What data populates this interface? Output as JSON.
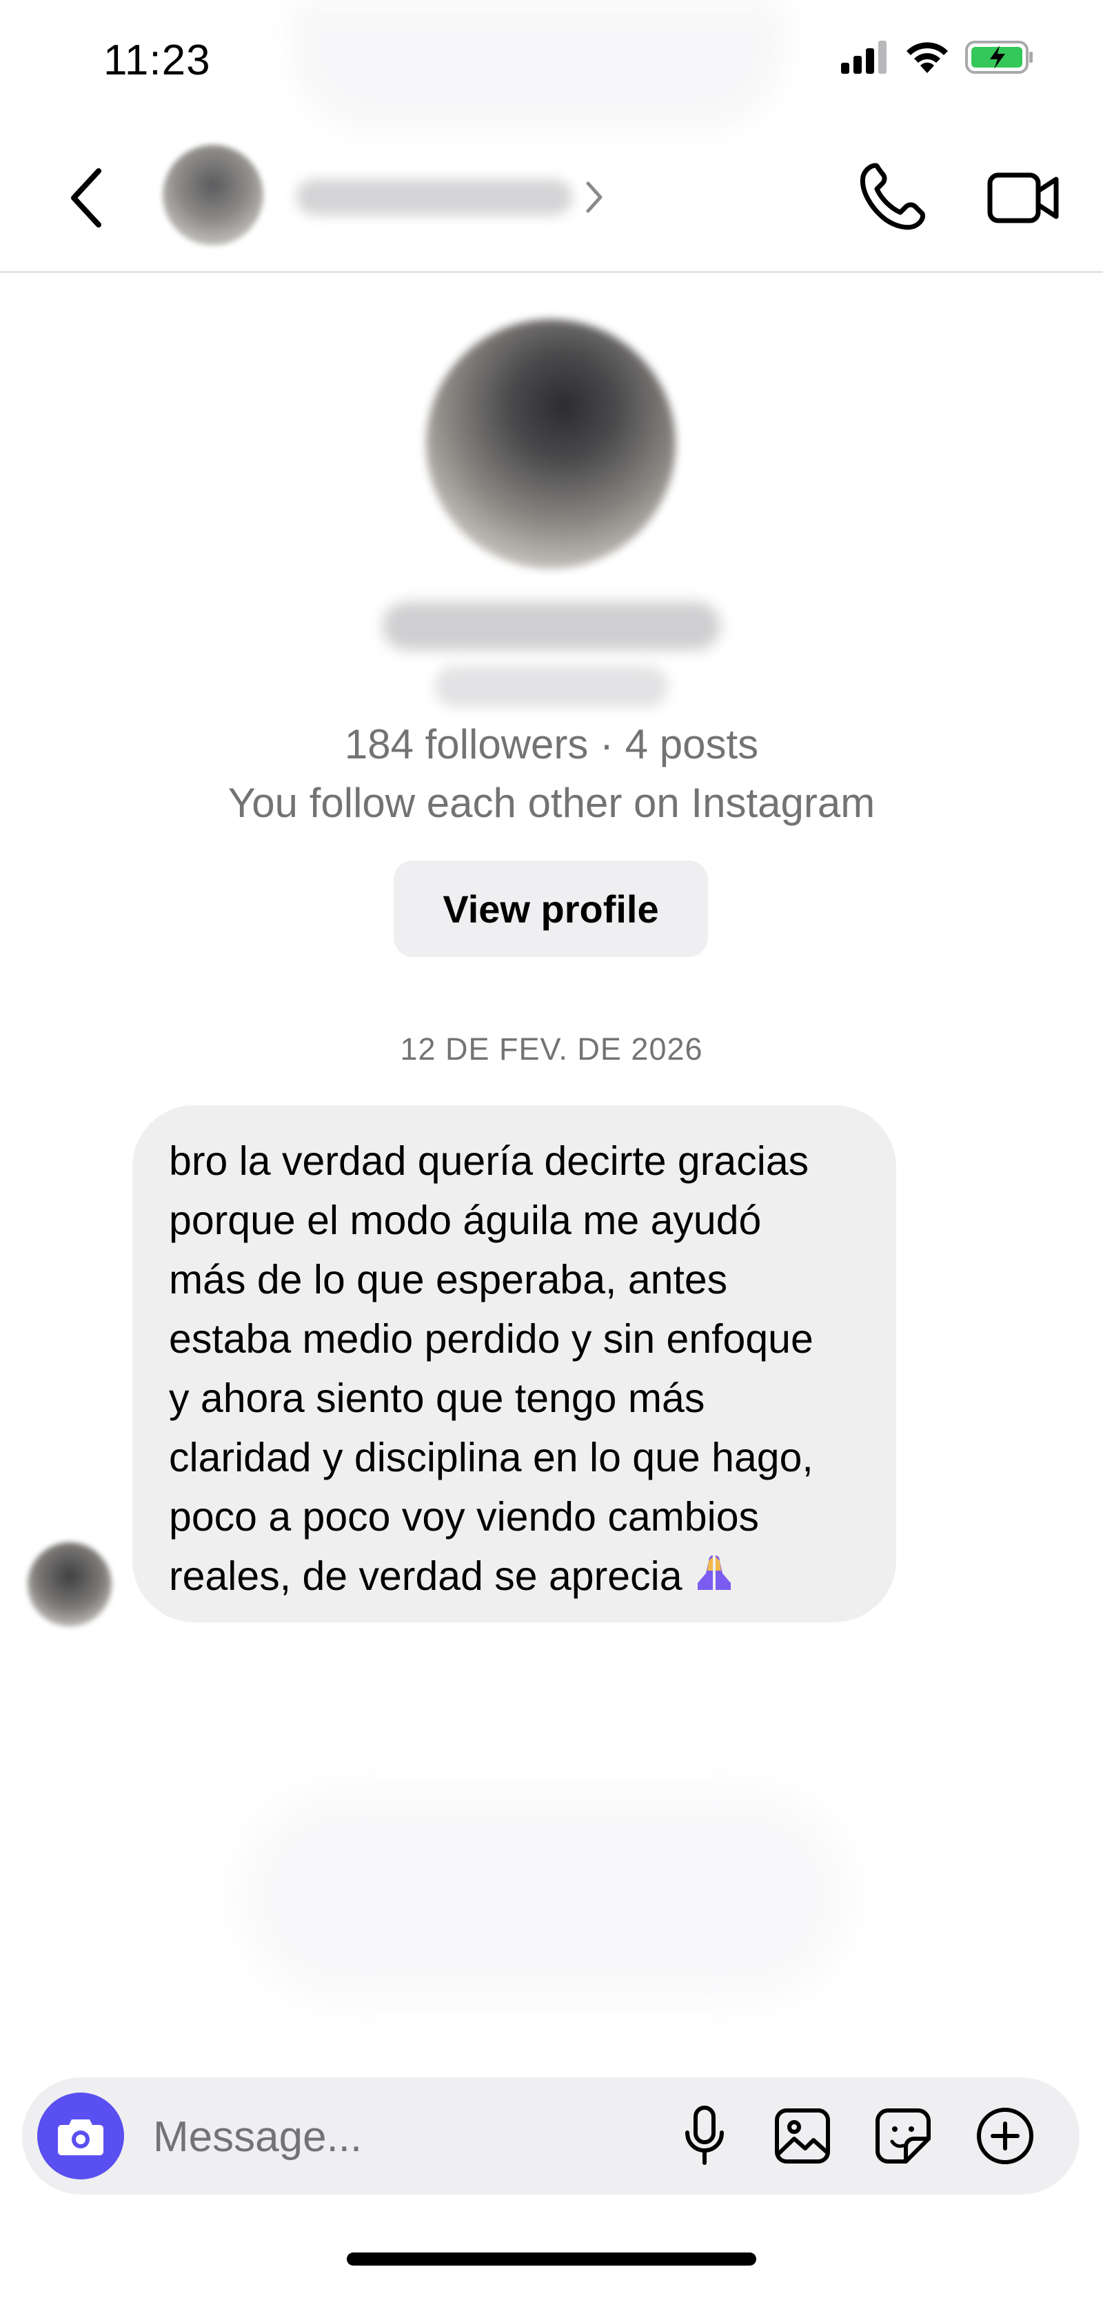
{
  "status_bar": {
    "time": "11:23",
    "icons": [
      "cellular-signal-icon",
      "wifi-icon",
      "battery-charging-icon"
    ]
  },
  "header": {
    "icons": [
      "chevron-left-icon",
      "chevron-right-icon",
      "phone-icon",
      "video-camera-icon"
    ]
  },
  "profile": {
    "stats": "184 followers · 4 posts",
    "mutual": "You follow each other on Instagram",
    "view_profile_label": "View profile"
  },
  "conversation": {
    "date_separator": "12 DE FEV. DE 2026",
    "messages": [
      {
        "text": "bro la verdad quería decirte gracias\nporque el modo águila me ayudó\nmás de lo que esperaba, antes\nestaba medio perdido y sin enfoque\ny ahora siento que tengo más\nclaridad y disciplina en lo que hago,\npoco a poco voy viendo cambios\nreales, de verdad se aprecia",
        "emoji": "folded-hands-icon"
      }
    ]
  },
  "composer": {
    "placeholder": "Message...",
    "icons": [
      "camera-icon",
      "microphone-icon",
      "image-icon",
      "sticker-icon",
      "plus-circle-icon"
    ]
  },
  "colors": {
    "accent": "#5a4ff0",
    "bubble": "#efefef",
    "secondary_text": "#737376",
    "battery_green": "#34c759"
  }
}
